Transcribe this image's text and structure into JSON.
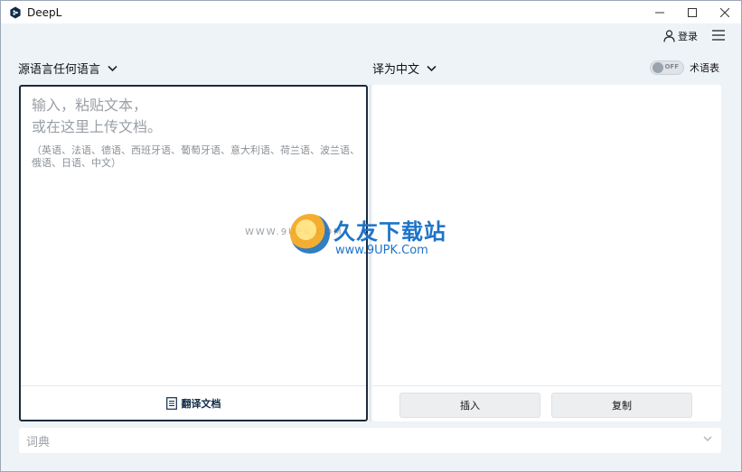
{
  "window": {
    "title": "DeepL"
  },
  "header": {
    "login_label": "登录"
  },
  "source": {
    "language_label": "源语言任何语言",
    "placeholder_line1": "输入，粘贴文本，",
    "placeholder_line2": "或在这里上传文档。",
    "languages_hint": "（英语、法语、德语、西班牙语、葡萄牙语、意大利语、荷兰语、波兰语、俄语、日语、中文）",
    "translate_document_label": "翻译文档"
  },
  "target": {
    "language_label": "译为中文",
    "glossary_toggle_state": "OFF",
    "glossary_label": "术语表",
    "insert_label": "插入",
    "copy_label": "复制"
  },
  "dictionary": {
    "label": "词典"
  },
  "watermark": {
    "title": "久友下载站",
    "url": "www.9UPK.Com",
    "url_left": "WWW.9UPK.COM"
  }
}
